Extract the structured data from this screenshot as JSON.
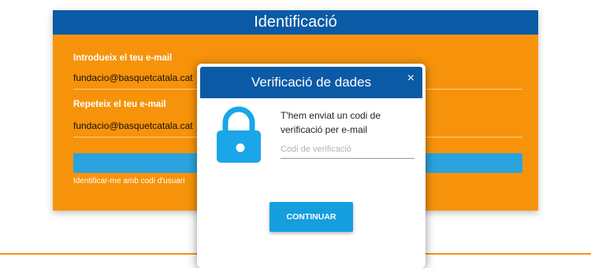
{
  "identification": {
    "title": "Identificació",
    "email_label": "Introdueix el teu e-mail",
    "email_value": "fundacio@basquetcatala.cat",
    "repeat_label": "Repeteix el teu e-mail",
    "repeat_value": "fundacio@basquetcatala.cat",
    "alt_link": "Identificar-me amb codi d'usuari"
  },
  "modal": {
    "title": "Verificació de dades",
    "close": "×",
    "message": "T'hem enviat un codi de verificació per e-mail",
    "code_placeholder": "Codi de verificació",
    "continue_label": "CONTINUAR",
    "icon": "lock-icon"
  },
  "colors": {
    "orange": "#f7930a",
    "header_blue": "#0a5aa6",
    "button_blue": "#159fde",
    "lock_blue": "#1aa6e8"
  }
}
